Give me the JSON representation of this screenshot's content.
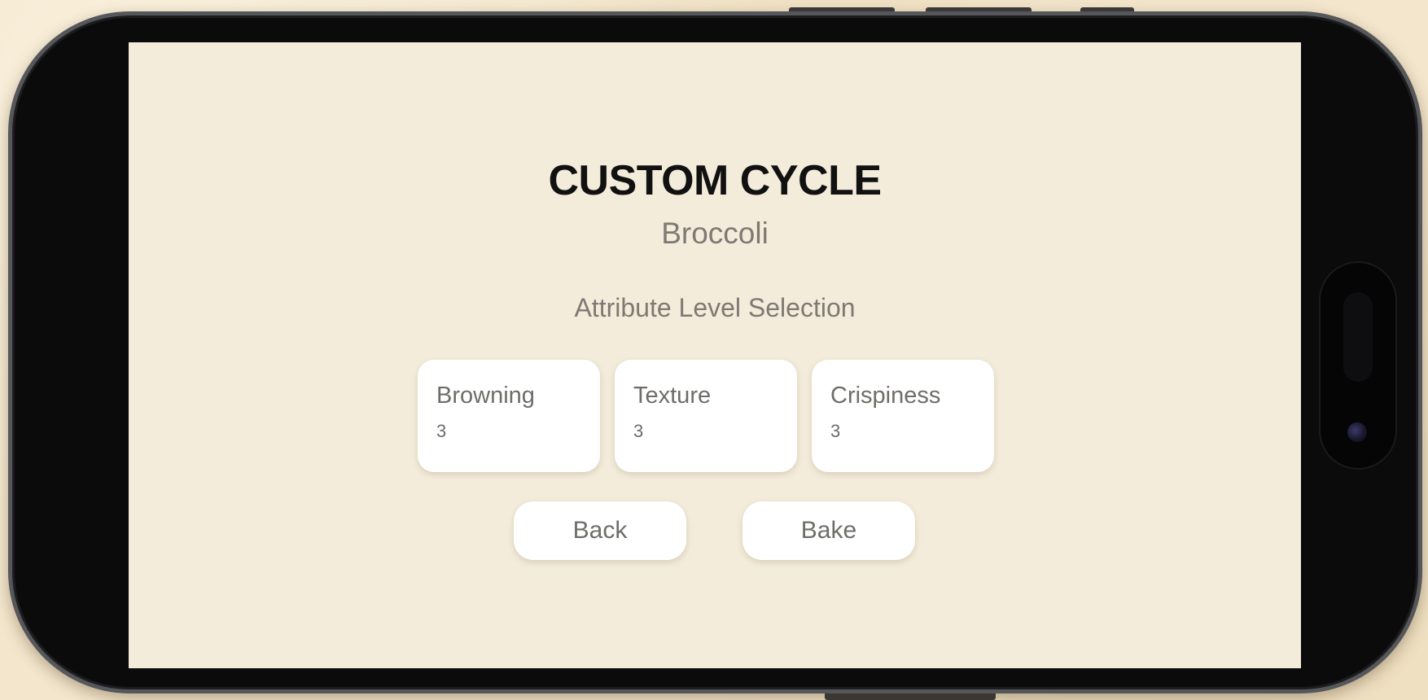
{
  "screen": {
    "title": "CUSTOM CYCLE",
    "subtitle": "Broccoli",
    "section_label": "Attribute Level Selection"
  },
  "attributes": [
    {
      "label": "Browning",
      "value": "3"
    },
    {
      "label": "Texture",
      "value": "3"
    },
    {
      "label": "Crispiness",
      "value": "3"
    }
  ],
  "actions": {
    "back_label": "Back",
    "bake_label": "Bake"
  },
  "colors": {
    "background": "#f3e6cc",
    "screen": "#f4ecdb",
    "card": "#ffffff",
    "title_text": "#111111",
    "muted_text": "#7d7a74"
  }
}
